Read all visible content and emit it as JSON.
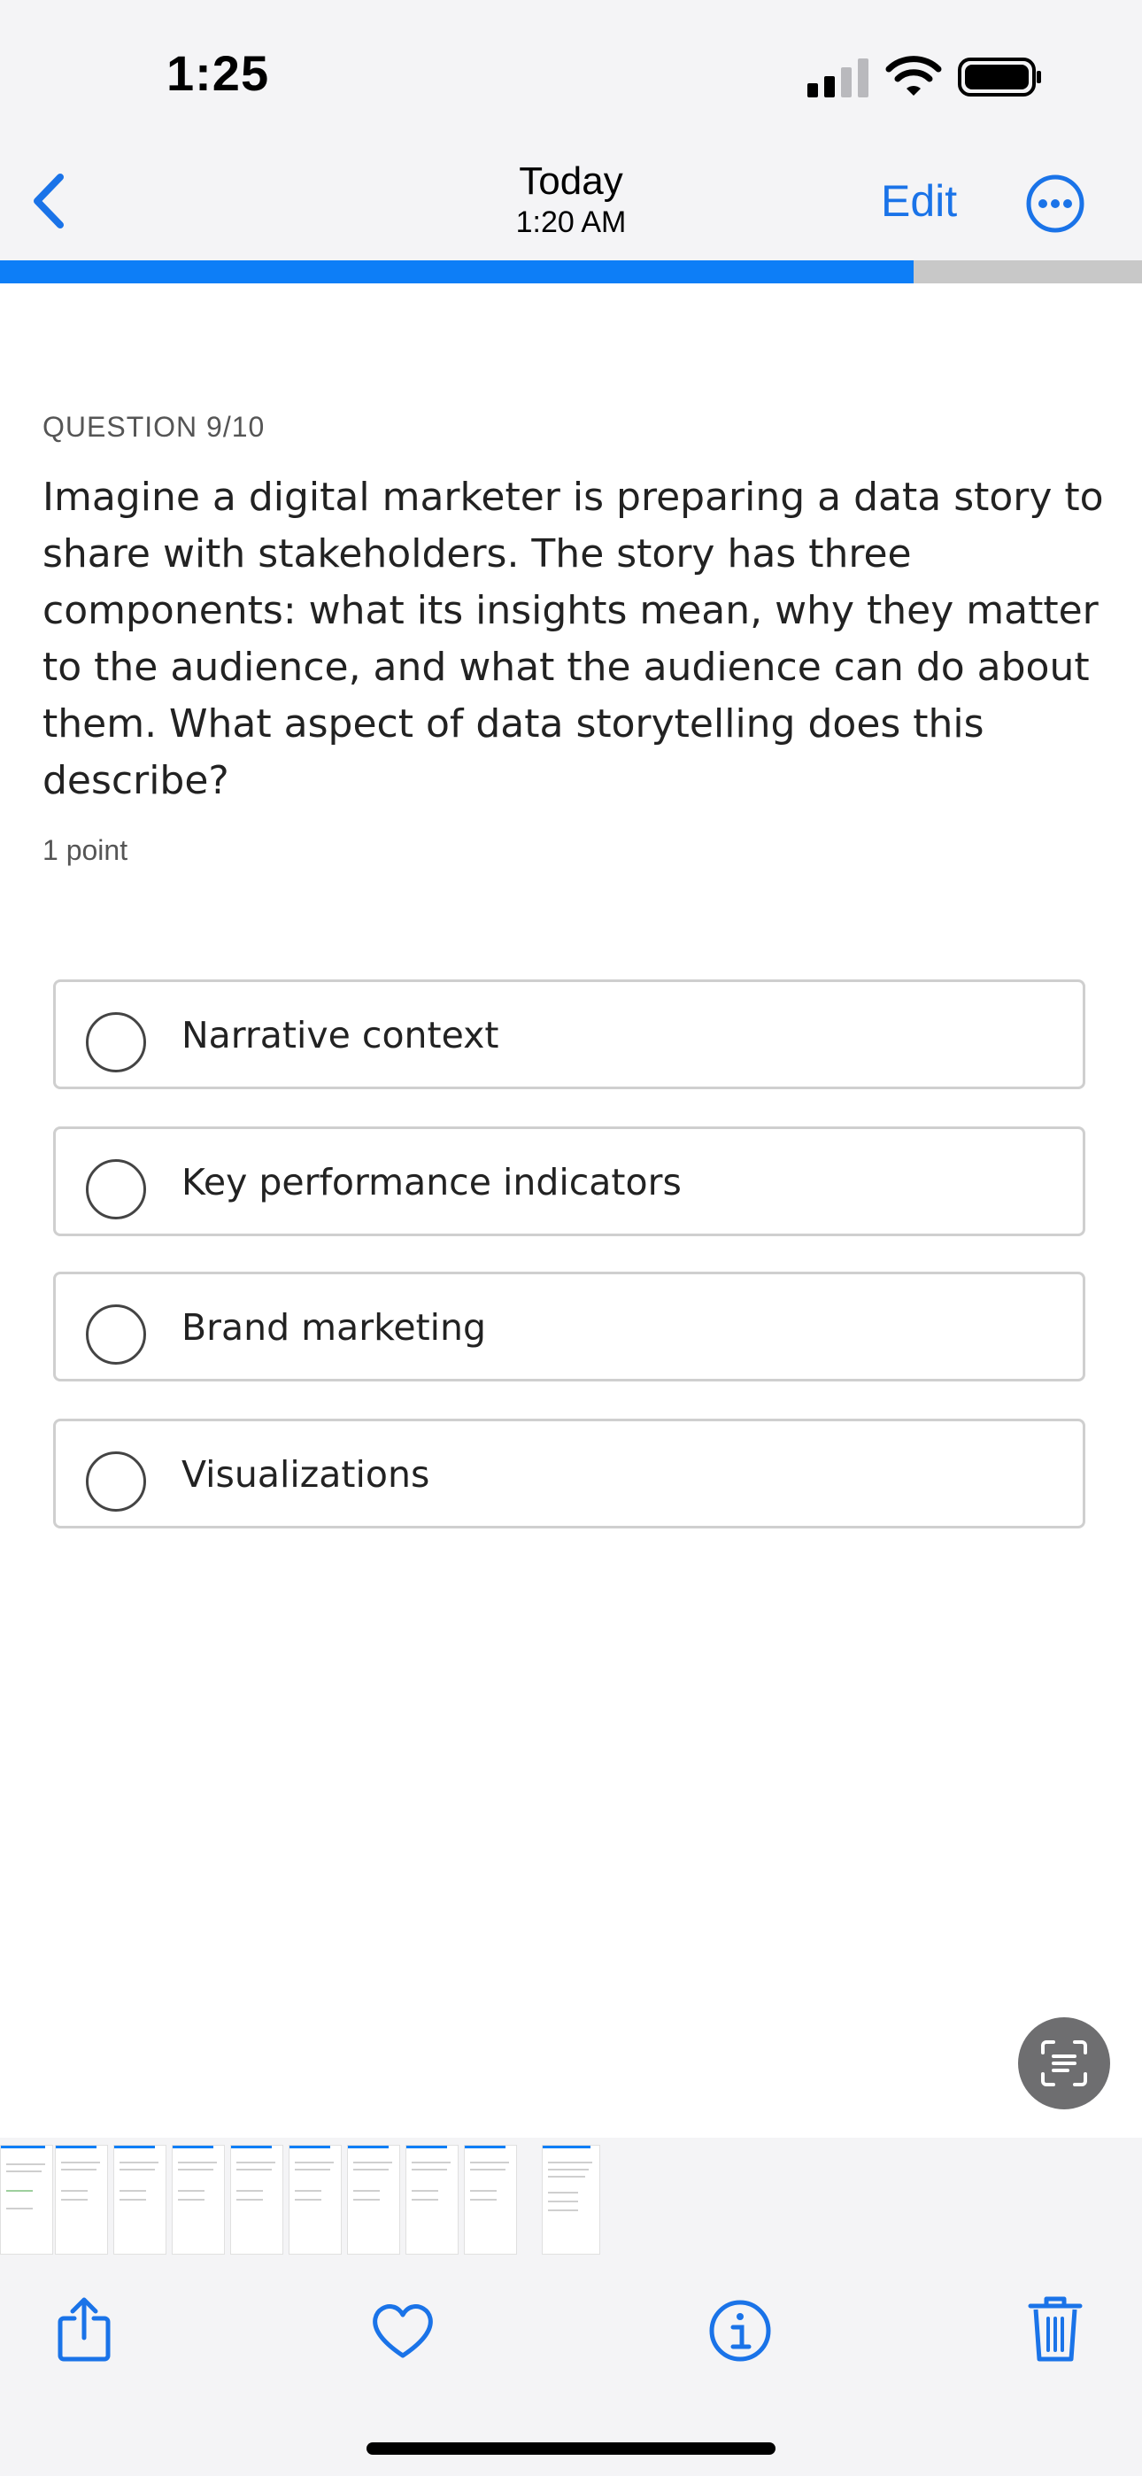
{
  "status_bar": {
    "time": "1:25"
  },
  "nav": {
    "title": "Today",
    "subtitle": "1:20 AM",
    "edit_label": "Edit"
  },
  "quiz": {
    "progress": 0.8,
    "question_label": "QUESTION 9/10",
    "question_text": "Imagine a digital marketer is preparing a data story to share with stakeholders. The story has three components: what its insights mean, why they matter to the audience, and what the audience can do about them. What aspect of data storytelling does this describe?",
    "points": "1 point",
    "options": [
      {
        "label": "Narrative context"
      },
      {
        "label": "Key performance indicators"
      },
      {
        "label": "Brand marketing"
      },
      {
        "label": "Visualizations"
      }
    ]
  },
  "toolbar": {
    "icons": [
      "share-icon",
      "heart-icon",
      "info-icon",
      "trash-icon"
    ],
    "accent": "#1a73e8"
  },
  "colors": {
    "accent": "#1a73e8",
    "progress": "#0d7ef7",
    "progress_track": "#c8c8c8"
  }
}
